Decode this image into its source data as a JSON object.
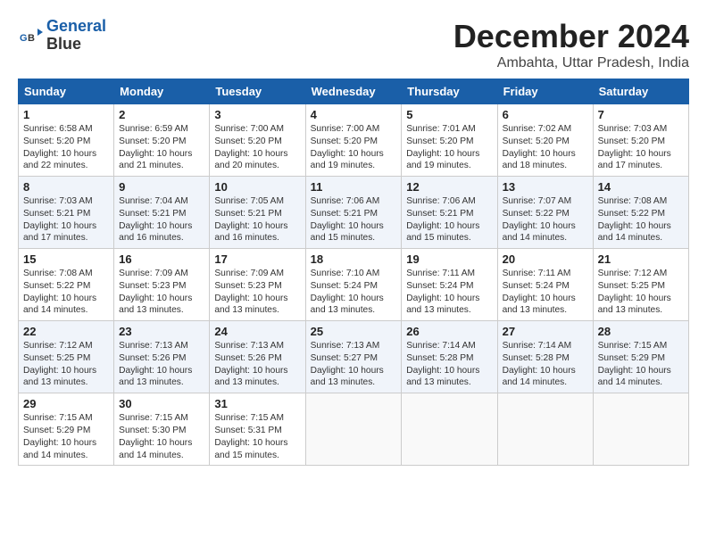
{
  "logo": {
    "line1": "General",
    "line2": "Blue"
  },
  "title": "December 2024",
  "location": "Ambahta, Uttar Pradesh, India",
  "weekdays": [
    "Sunday",
    "Monday",
    "Tuesday",
    "Wednesday",
    "Thursday",
    "Friday",
    "Saturday"
  ],
  "weeks": [
    [
      {
        "day": "1",
        "info": "Sunrise: 6:58 AM\nSunset: 5:20 PM\nDaylight: 10 hours\nand 22 minutes."
      },
      {
        "day": "2",
        "info": "Sunrise: 6:59 AM\nSunset: 5:20 PM\nDaylight: 10 hours\nand 21 minutes."
      },
      {
        "day": "3",
        "info": "Sunrise: 7:00 AM\nSunset: 5:20 PM\nDaylight: 10 hours\nand 20 minutes."
      },
      {
        "day": "4",
        "info": "Sunrise: 7:00 AM\nSunset: 5:20 PM\nDaylight: 10 hours\nand 19 minutes."
      },
      {
        "day": "5",
        "info": "Sunrise: 7:01 AM\nSunset: 5:20 PM\nDaylight: 10 hours\nand 19 minutes."
      },
      {
        "day": "6",
        "info": "Sunrise: 7:02 AM\nSunset: 5:20 PM\nDaylight: 10 hours\nand 18 minutes."
      },
      {
        "day": "7",
        "info": "Sunrise: 7:03 AM\nSunset: 5:20 PM\nDaylight: 10 hours\nand 17 minutes."
      }
    ],
    [
      {
        "day": "8",
        "info": "Sunrise: 7:03 AM\nSunset: 5:21 PM\nDaylight: 10 hours\nand 17 minutes."
      },
      {
        "day": "9",
        "info": "Sunrise: 7:04 AM\nSunset: 5:21 PM\nDaylight: 10 hours\nand 16 minutes."
      },
      {
        "day": "10",
        "info": "Sunrise: 7:05 AM\nSunset: 5:21 PM\nDaylight: 10 hours\nand 16 minutes."
      },
      {
        "day": "11",
        "info": "Sunrise: 7:06 AM\nSunset: 5:21 PM\nDaylight: 10 hours\nand 15 minutes."
      },
      {
        "day": "12",
        "info": "Sunrise: 7:06 AM\nSunset: 5:21 PM\nDaylight: 10 hours\nand 15 minutes."
      },
      {
        "day": "13",
        "info": "Sunrise: 7:07 AM\nSunset: 5:22 PM\nDaylight: 10 hours\nand 14 minutes."
      },
      {
        "day": "14",
        "info": "Sunrise: 7:08 AM\nSunset: 5:22 PM\nDaylight: 10 hours\nand 14 minutes."
      }
    ],
    [
      {
        "day": "15",
        "info": "Sunrise: 7:08 AM\nSunset: 5:22 PM\nDaylight: 10 hours\nand 14 minutes."
      },
      {
        "day": "16",
        "info": "Sunrise: 7:09 AM\nSunset: 5:23 PM\nDaylight: 10 hours\nand 13 minutes."
      },
      {
        "day": "17",
        "info": "Sunrise: 7:09 AM\nSunset: 5:23 PM\nDaylight: 10 hours\nand 13 minutes."
      },
      {
        "day": "18",
        "info": "Sunrise: 7:10 AM\nSunset: 5:24 PM\nDaylight: 10 hours\nand 13 minutes."
      },
      {
        "day": "19",
        "info": "Sunrise: 7:11 AM\nSunset: 5:24 PM\nDaylight: 10 hours\nand 13 minutes."
      },
      {
        "day": "20",
        "info": "Sunrise: 7:11 AM\nSunset: 5:24 PM\nDaylight: 10 hours\nand 13 minutes."
      },
      {
        "day": "21",
        "info": "Sunrise: 7:12 AM\nSunset: 5:25 PM\nDaylight: 10 hours\nand 13 minutes."
      }
    ],
    [
      {
        "day": "22",
        "info": "Sunrise: 7:12 AM\nSunset: 5:25 PM\nDaylight: 10 hours\nand 13 minutes."
      },
      {
        "day": "23",
        "info": "Sunrise: 7:13 AM\nSunset: 5:26 PM\nDaylight: 10 hours\nand 13 minutes."
      },
      {
        "day": "24",
        "info": "Sunrise: 7:13 AM\nSunset: 5:26 PM\nDaylight: 10 hours\nand 13 minutes."
      },
      {
        "day": "25",
        "info": "Sunrise: 7:13 AM\nSunset: 5:27 PM\nDaylight: 10 hours\nand 13 minutes."
      },
      {
        "day": "26",
        "info": "Sunrise: 7:14 AM\nSunset: 5:28 PM\nDaylight: 10 hours\nand 13 minutes."
      },
      {
        "day": "27",
        "info": "Sunrise: 7:14 AM\nSunset: 5:28 PM\nDaylight: 10 hours\nand 14 minutes."
      },
      {
        "day": "28",
        "info": "Sunrise: 7:15 AM\nSunset: 5:29 PM\nDaylight: 10 hours\nand 14 minutes."
      }
    ],
    [
      {
        "day": "29",
        "info": "Sunrise: 7:15 AM\nSunset: 5:29 PM\nDaylight: 10 hours\nand 14 minutes."
      },
      {
        "day": "30",
        "info": "Sunrise: 7:15 AM\nSunset: 5:30 PM\nDaylight: 10 hours\nand 14 minutes."
      },
      {
        "day": "31",
        "info": "Sunrise: 7:15 AM\nSunset: 5:31 PM\nDaylight: 10 hours\nand 15 minutes."
      },
      {
        "day": "",
        "info": ""
      },
      {
        "day": "",
        "info": ""
      },
      {
        "day": "",
        "info": ""
      },
      {
        "day": "",
        "info": ""
      }
    ]
  ]
}
